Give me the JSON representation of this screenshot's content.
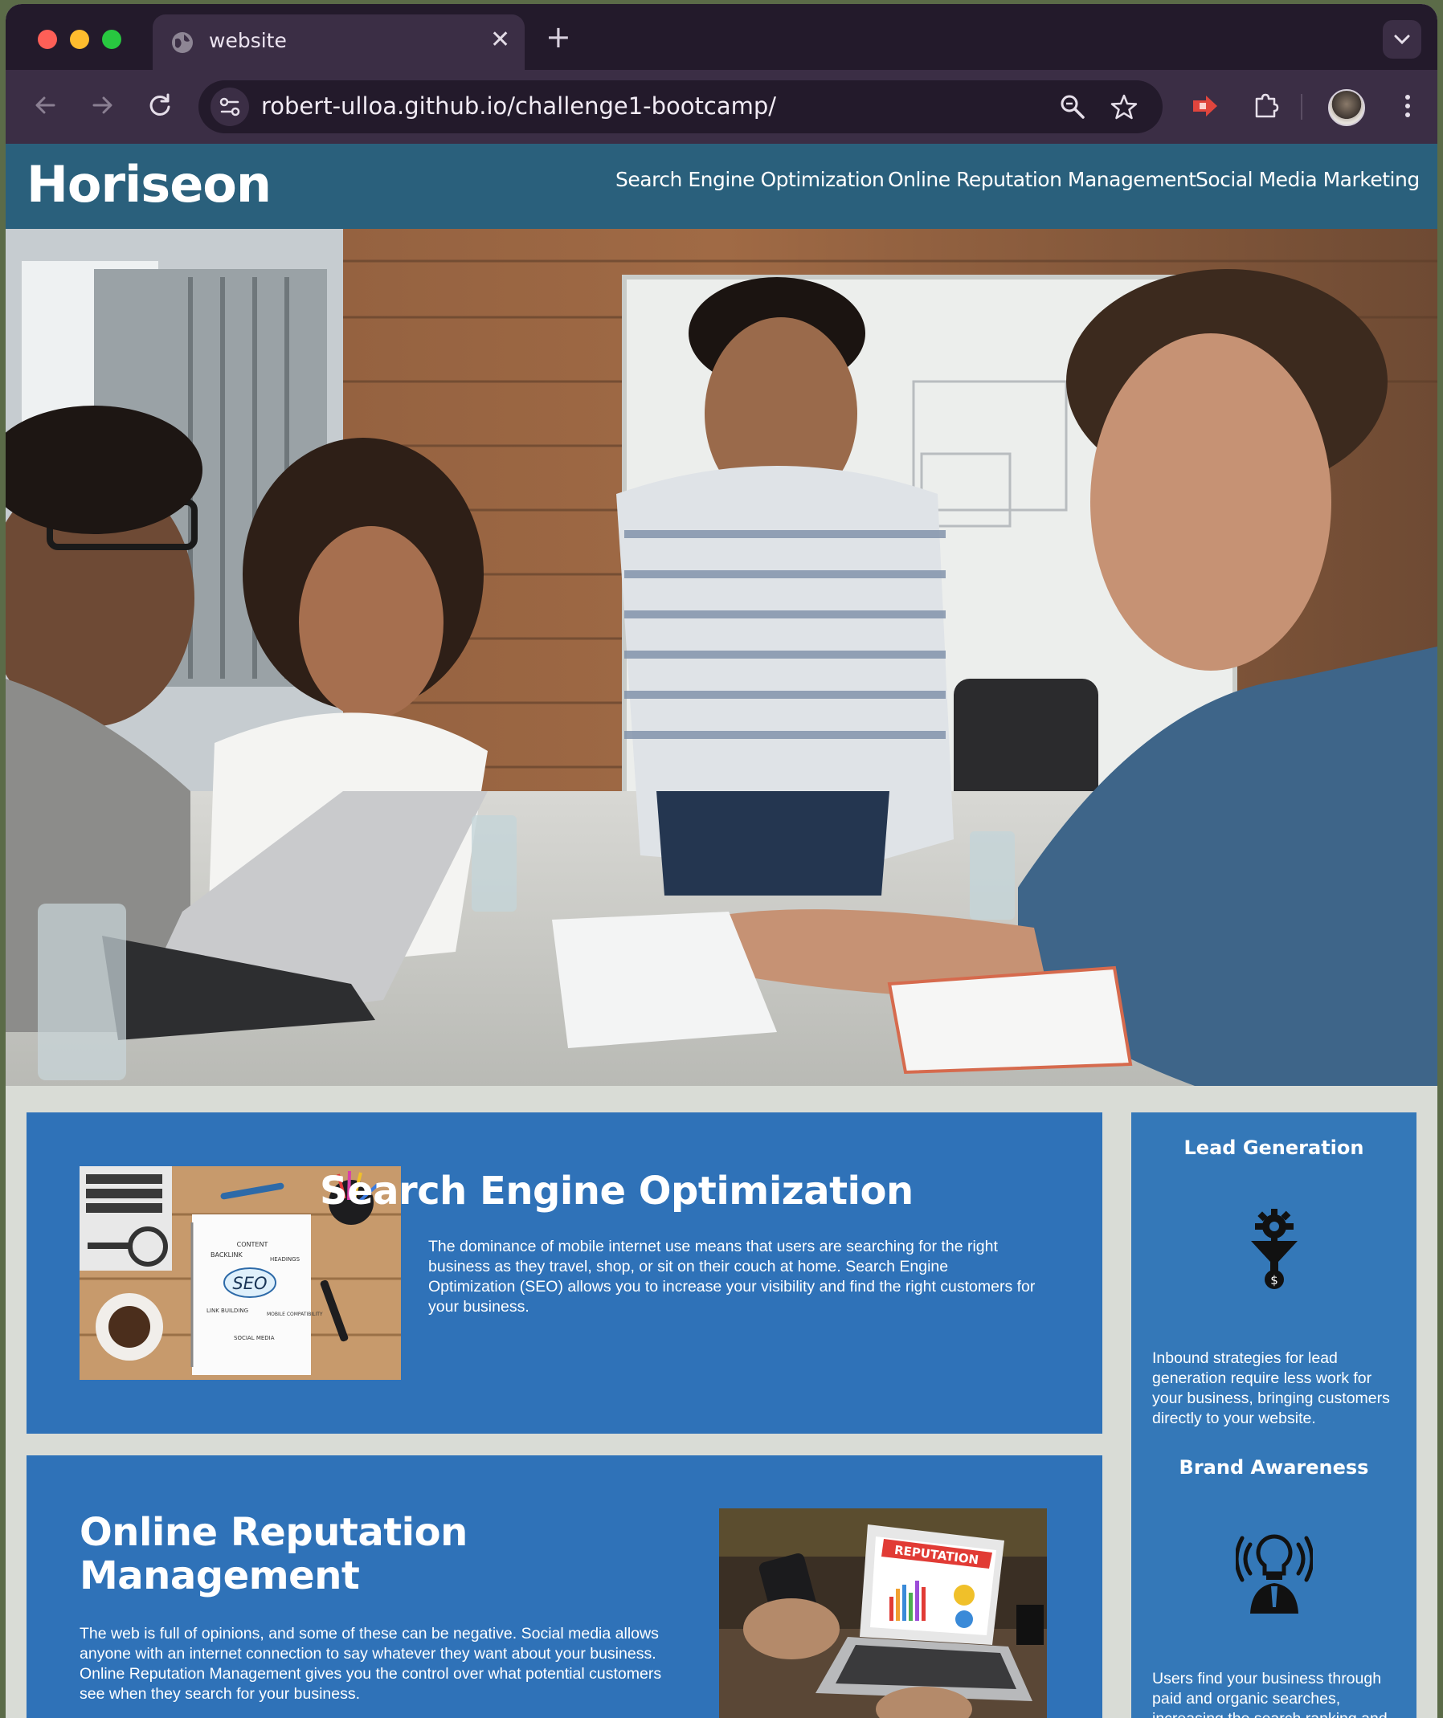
{
  "browser": {
    "tab_title": "website",
    "tab_close": "✕",
    "new_tab": "+",
    "url": "robert-ulloa.github.io/challenge1-bootcamp/",
    "icons": [
      "globe-icon",
      "back-icon",
      "forward-icon",
      "reload-icon",
      "site-info-icon",
      "zoom-icon",
      "bookmark-star-icon",
      "extension-arrow-icon",
      "extensions-puzzle-icon",
      "profile-avatar",
      "menu-dots-icon",
      "tab-dropdown-icon"
    ]
  },
  "site": {
    "logo": "Horiseon",
    "nav": [
      {
        "label": "Search Engine Optimization"
      },
      {
        "label": "Online Reputation Management"
      },
      {
        "label": "Social Media Marketing"
      }
    ],
    "colors": {
      "header": "#2a607c",
      "card": "#2f72b8",
      "sidebar": "#3478b8",
      "page_bg": "#d9dcd6"
    }
  },
  "content": {
    "seo": {
      "title": "Search Engine Optimization",
      "body": "The dominance of mobile internet use means that users are searching for the right business as they travel, shop, or sit on their couch at home. Search Engine Optimization (SEO) allows you to increase your visibility and find the right customers for your business.",
      "image_words": [
        "CONTENT",
        "BACKLINK",
        "HEADINGS",
        "SEO",
        "LINK BUILDING",
        "MOBILE COMPATIBILITY",
        "SOCIAL MEDIA"
      ]
    },
    "orm": {
      "title_line1": "Online Reputation",
      "title_line2": "Management",
      "body": "The web is full of opinions, and some of these can be negative. Social media allows anyone with an internet connection to say whatever they want about your business. Online Reputation Management gives you the control over what potential customers see when they search for your business.",
      "image_word": "REPUTATION"
    }
  },
  "sidebar": {
    "lead": {
      "title": "Lead Generation",
      "body": "Inbound strategies for lead generation require less work for your business, bringing customers directly to your website.",
      "icon": "lead-funnel-icon"
    },
    "brand": {
      "title": "Brand Awareness",
      "body": "Users find your business through paid and organic searches, increasing the search ranking and",
      "icon": "brand-lightbulb-icon"
    }
  }
}
